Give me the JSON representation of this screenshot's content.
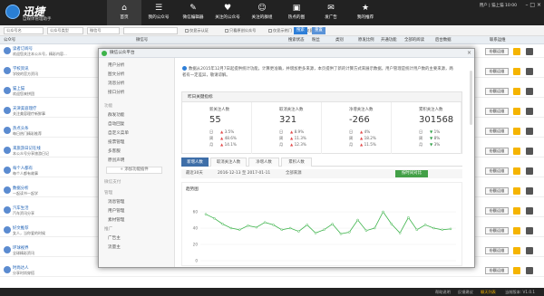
{
  "app": {
    "name": "迅捷",
    "slogan": "自媒体管理助手"
  },
  "nav": [
    {
      "label": "首页",
      "icon": "home-icon",
      "glyph": "⌂"
    },
    {
      "label": "我的公众号",
      "icon": "account-icon",
      "glyph": "☰"
    },
    {
      "label": "微信编辑器",
      "icon": "editor-icon",
      "glyph": "✎"
    },
    {
      "label": "关注的公众号",
      "icon": "follow-icon",
      "glyph": "♥"
    },
    {
      "label": "关注的群组",
      "icon": "group-icon",
      "glyph": "☺"
    },
    {
      "label": "热点的图",
      "icon": "image-icon",
      "glyph": "▣"
    },
    {
      "label": "发广告",
      "icon": "ad-icon",
      "glyph": "✉"
    },
    {
      "label": "我的推荐",
      "icon": "recommend-icon",
      "glyph": "★"
    }
  ],
  "user": {
    "text": "用户  |  猫上猫    10:00"
  },
  "window_controls": "– □ ×",
  "toolbar": {
    "input1": "公众号名",
    "select1": "公众号类型",
    "select2": "微信号",
    "search_placeholder": "",
    "check1": "仅显示认证",
    "check2": "只看原创公众号",
    "check3": "仅显示热门",
    "check4": "仅显示独立",
    "search_btn": "搜索",
    "reset_btn": "重置"
  },
  "table": {
    "headers": [
      "公众号",
      "微信号",
      "搜索状态",
      "粉丝",
      "类别",
      "原发比例",
      "开通功能",
      "全部的阅读",
      "后台数据",
      "联系运维"
    ],
    "rows": [
      {
        "name": "读者订阅号",
        "desc": "欢迎您关注本公众号，精彩内容...",
        "btn": "份额运维"
      },
      {
        "name": "学校资讯",
        "desc": "学校的官方资讯",
        "btn": "份额运维"
      },
      {
        "name": "猫上猫",
        "desc": "欢迎您来拼团",
        "btn": "份额运维"
      },
      {
        "name": "天津美容理疗",
        "desc": "关注美容理疗新鲜事",
        "btn": "份额运维"
      },
      {
        "name": "热点头条",
        "desc": "每日热门精彩推荐",
        "btn": "份额运维"
      },
      {
        "name": "来旅游日记在线",
        "desc": "本公众号分享旅游日记",
        "btn": "份额运维"
      },
      {
        "name": "每个人都有",
        "desc": "每个人都有故事",
        "btn": "份额运维"
      },
      {
        "name": "数据分析",
        "desc": "一起读书一起学",
        "btn": "份额运维"
      },
      {
        "name": "汽车生活",
        "desc": "汽车资讯分享",
        "btn": "份额运维"
      },
      {
        "name": "好文推荐",
        "desc": "女人，当你爱的时候",
        "btn": "份额运维"
      },
      {
        "name": "环球视界",
        "desc": "全球精彩资讯",
        "btn": "份额运维"
      },
      {
        "name": "时尚达人",
        "desc": "分享时尚穿搭",
        "btn": "份额运维"
      }
    ]
  },
  "statusbar": {
    "left": "帮助说明",
    "mid": "反馈建议",
    "right1": "聊天列表",
    "right2": "当前版本: V1.0.1"
  },
  "popup": {
    "title": "微信公众平台",
    "close": "×",
    "sidebar": {
      "groups": [
        {
          "label": "功能",
          "items": [
            "群发功能",
            "自动回复",
            "自定义菜单",
            "投票管理",
            "多客服",
            "原创声明"
          ]
        },
        {
          "label": "管理",
          "items": [
            "消息管理",
            "用户管理",
            "素材管理"
          ]
        },
        {
          "label": "推广",
          "items": [
            "广告主",
            "流量主"
          ]
        }
      ],
      "top_items": [
        "用户分析",
        "图文分析",
        "消息分析",
        "接口分析"
      ],
      "add_btn": "+ 添加功能插件",
      "extra": "微信支付"
    },
    "notice": "数据从2015年12月7日起提供统计功能，计算更准确，并增加更多来源，本页提供了新的计算方式来展示数据，用户管理是统计用户数的主要来源，两者有一定差异，敬请谅解。",
    "panel_title": "昨日关键指标",
    "kpis": [
      {
        "label": "新关注人数",
        "value": "55",
        "rows": [
          {
            "k": "日",
            "v": "3.5%",
            "dir": "up"
          },
          {
            "k": "周",
            "v": "48.6%",
            "dir": "up"
          },
          {
            "k": "月",
            "v": "14.1%",
            "dir": "up"
          }
        ]
      },
      {
        "label": "取消关注人数",
        "value": "321",
        "rows": [
          {
            "k": "日",
            "v": "8.9%",
            "dir": "up"
          },
          {
            "k": "周",
            "v": "11.3%",
            "dir": "up"
          },
          {
            "k": "月",
            "v": "12.3%",
            "dir": "up"
          }
        ]
      },
      {
        "label": "净增关注人数",
        "value": "-266",
        "rows": [
          {
            "k": "日",
            "v": "4%",
            "dir": "up"
          },
          {
            "k": "周",
            "v": "18.2%",
            "dir": "up"
          },
          {
            "k": "月",
            "v": "11.5%",
            "dir": "up"
          }
        ]
      },
      {
        "label": "累积关注人数",
        "value": "301568",
        "rows": [
          {
            "k": "日",
            "v": "1%",
            "dir": "dn"
          },
          {
            "k": "周",
            "v": "8%",
            "dir": "dn"
          },
          {
            "k": "月",
            "v": "3%",
            "dir": "dn"
          }
        ]
      }
    ],
    "tabs": [
      "新增人数",
      "取消关注人数",
      "净增人数",
      "累积人数"
    ],
    "filter": {
      "range": "最近30天",
      "dates": "2016-12-13 至 2017-01-11",
      "channel": "全部来源",
      "export": "按时间对比"
    },
    "chart_title": "趋势图"
  },
  "chart_data": {
    "type": "line",
    "title": "趋势图",
    "xlabel": "",
    "ylabel": "",
    "ylim": [
      0,
      80
    ],
    "yticks": [
      0,
      20,
      40,
      60
    ],
    "color": "#3cb34a",
    "series": [
      {
        "values": [
          57,
          52,
          45,
          40,
          38,
          43,
          41,
          47,
          44,
          38,
          40,
          36,
          44,
          34,
          38,
          45,
          33,
          35,
          50,
          37,
          40,
          60,
          45,
          34,
          53,
          38,
          44,
          40,
          38,
          39
        ]
      }
    ]
  }
}
